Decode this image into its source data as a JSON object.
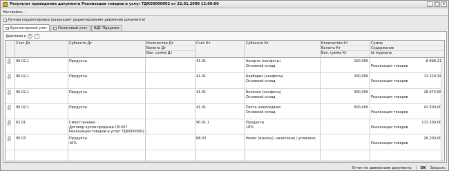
{
  "window": {
    "title": "Результат проведения документа Реализация товаров и услуг ТДК00000002 от 22.01.2008 12:00:00",
    "buttons": [
      "_",
      "□",
      "×"
    ]
  },
  "menu": {
    "settings": "Настройка..."
  },
  "manual_correction": {
    "label": "Ручная корректировка (разрешает редактирование движений документа)",
    "checked": false
  },
  "tabs": [
    {
      "label": "Бухгалтерский учет",
      "active": true
    },
    {
      "label": "Налоговый учет",
      "active": false
    },
    {
      "label": "НДС Продажи",
      "active": false
    }
  ],
  "toolbar": {
    "actions_label": "Действия",
    "actions_arrow": "▾"
  },
  "table": {
    "headers": {
      "debit_account": "Счет Дт",
      "subconto_debit": "Субконто Дт",
      "qty_debit": "Количество Дт",
      "currency_debit": "Валюта Дт",
      "cur_sum_debit": "Вал. сумма Дт",
      "credit_account": "Счет Кт",
      "subconto_credit": "Субконто Кт",
      "qty_credit": "Количество Кт",
      "currency_credit": "Валюта Кт",
      "cur_sum_credit": "Вал. сумма Кт",
      "sum": "Сумма",
      "content": "Содержание",
      "journal": "№ журнала"
    },
    "rows": [
      {
        "dt": "90.02.1",
        "sub_dt": [
          "Продукты",
          "",
          ""
        ],
        "kt": "41.01",
        "sub_kt": [
          "Ассорти (конфеты)",
          "Основной склад",
          ""
        ],
        "qty_kt": "100,000",
        "sum": "8 898,21",
        "content": "Реализация товаров"
      },
      {
        "dt": "90.02.1",
        "sub_dt": [
          "Продукты",
          "",
          ""
        ],
        "kt": "41.01",
        "sub_kt": [
          "Барбарис (конфеты)",
          "Основной склад",
          ""
        ],
        "qty_kt": "200,000",
        "sum": "13 220,34",
        "content": "Реализация товаров"
      },
      {
        "dt": "90.02.1",
        "sub_dt": [
          "Продукты",
          "",
          ""
        ],
        "kt": "41.01",
        "sub_kt": [
          "Белочка (конфеты)",
          "Основной склад",
          ""
        ],
        "qty_kt": "300,000",
        "sum": "28 474,58",
        "content": "Реализация товаров"
      },
      {
        "dt": "90.02.1",
        "sub_dt": [
          "Продукты",
          "",
          ""
        ],
        "kt": "41.01",
        "sub_kt": [
          "Паста шоколадная",
          "Основной склад",
          ""
        ],
        "qty_kt": "500,000",
        "sum": "42 500,00",
        "content": "Реализация товаров"
      },
      {
        "dt": "62.01",
        "sub_dt": [
          "Смерттуненко",
          "Договор купли-продажи  СВ-567",
          "Реализация товаров и услуг ТДК0000002 ..."
        ],
        "kt": "90.01.1",
        "sub_kt": [
          "Продукты",
          "18%",
          ""
        ],
        "qty_kt": "",
        "sum": "172 200,00",
        "content": "Реализация товаров"
      },
      {
        "dt": "90.03",
        "sub_dt": [
          "Продукты",
          "10%",
          ""
        ],
        "kt": "68.02",
        "sub_kt": [
          "Налог (взносы): начислено / уплачено",
          "",
          ""
        ],
        "qty_kt": "",
        "sum": "26 200,00",
        "content": "Реализация товаров"
      }
    ]
  },
  "status": {
    "report_link": "Отчет по движениям документа",
    "ok": "OK",
    "close": "Закрыть"
  }
}
